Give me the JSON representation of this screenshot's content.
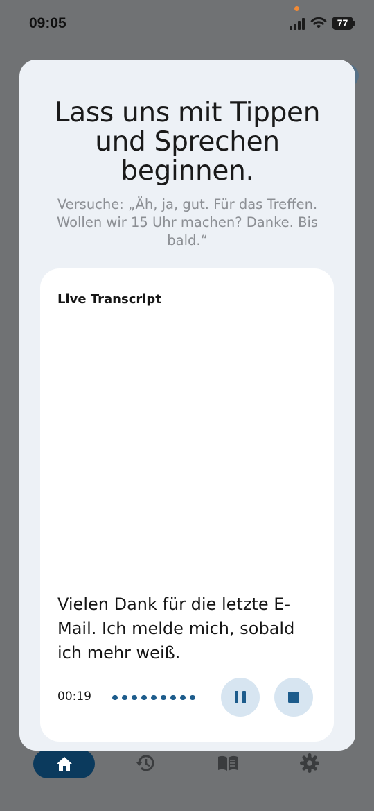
{
  "status_bar": {
    "time": "09:05",
    "battery": "77"
  },
  "sheet": {
    "title": "Lass uns mit Tippen und Sprechen beginnen.",
    "hint": "Versuche: „Äh, ja, gut. Für das Treffen. Wollen wir 15 Uhr machen? Danke. Bis bald.“"
  },
  "transcript_card": {
    "title": "Live Transcript",
    "text": "Vielen Dank für die letzte E-Mail. Ich melde mich, sobald ich mehr weiß.",
    "timer": "00:19",
    "controls": {
      "pause_icon": "pause-icon",
      "stop_icon": "stop-icon"
    }
  },
  "bottom_nav": {
    "items": [
      {
        "icon": "home-icon",
        "active": true
      },
      {
        "icon": "history-icon",
        "active": false
      },
      {
        "icon": "book-icon",
        "active": false
      },
      {
        "icon": "gear-icon",
        "active": false
      }
    ]
  },
  "colors": {
    "accent": "#1d5c8c",
    "sheet_bg": "#edf1f6",
    "scrim": "#707274",
    "nav_active": "#0b3a5d"
  }
}
